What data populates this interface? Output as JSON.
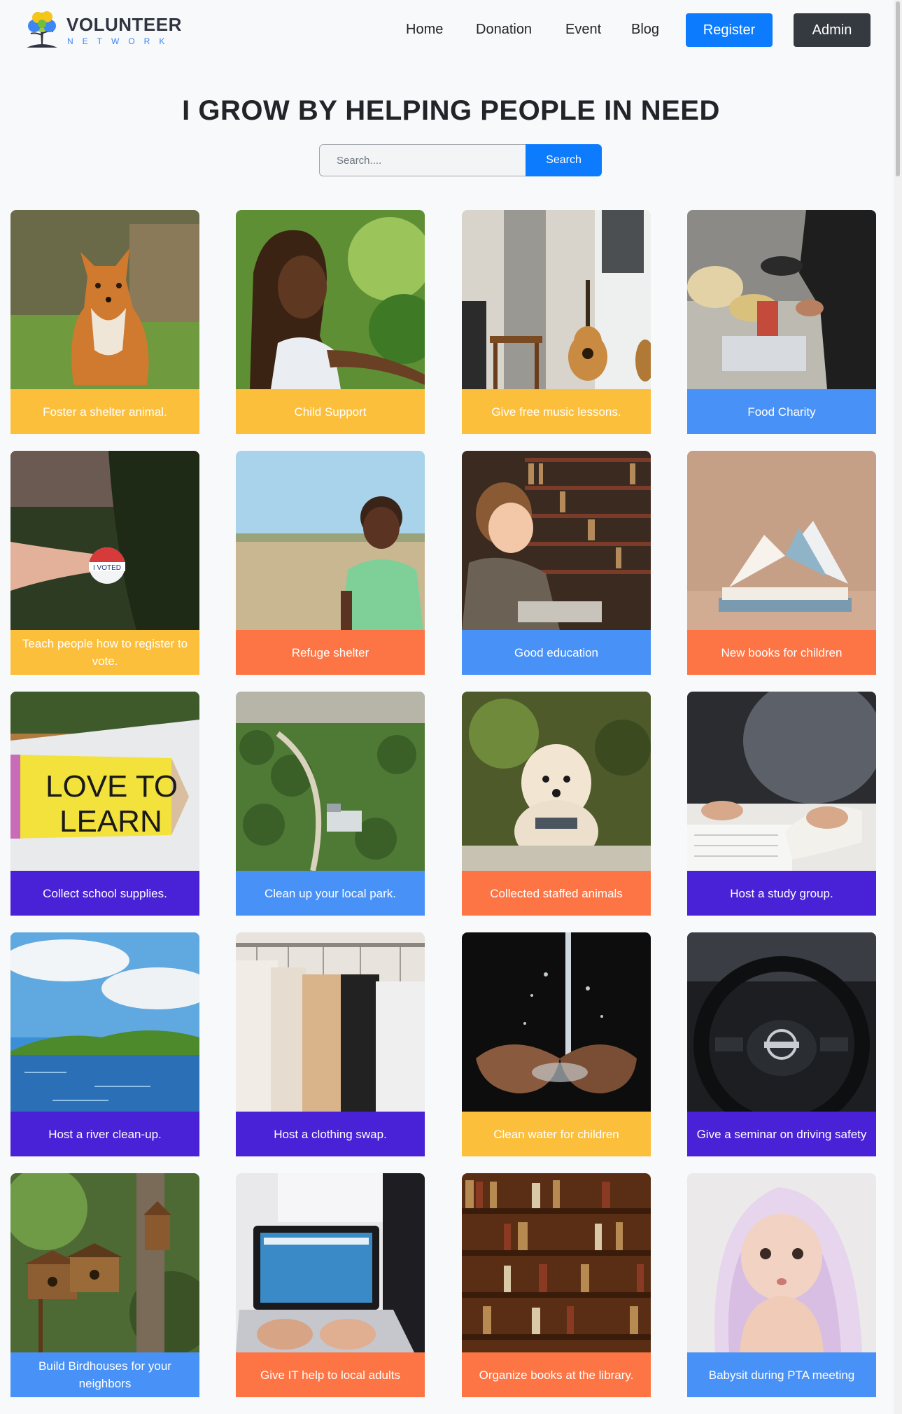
{
  "brand": {
    "title": "VOLUNTEER",
    "subtitle": "NETWORK"
  },
  "nav": {
    "home": "Home",
    "donation": "Donation",
    "event": "Event",
    "blog": "Blog",
    "register": "Register",
    "admin": "Admin"
  },
  "hero": {
    "title": "I GROW BY HELPING PEOPLE IN NEED"
  },
  "search": {
    "placeholder": "Search....",
    "button": "Search"
  },
  "colors": {
    "yellow": "#fcbf3c",
    "blue": "#4891f7",
    "orange": "#fd7545",
    "purple": "#4921d6",
    "primary": "#0d7bfd",
    "dark": "#343a40"
  },
  "events": [
    {
      "title": "Foster a shelter animal.",
      "color": "yellow",
      "image": "fox"
    },
    {
      "title": "Child Support",
      "color": "yellow",
      "image": "smiling-girl"
    },
    {
      "title": "Give free music lessons.",
      "color": "yellow",
      "image": "guitar-room"
    },
    {
      "title": "Food Charity",
      "color": "blue",
      "image": "food-sorting"
    },
    {
      "title": "Teach people how to register to vote.",
      "color": "yellow",
      "image": "voted-sticker"
    },
    {
      "title": "Refuge shelter",
      "color": "orange",
      "image": "boy-in-field"
    },
    {
      "title": "Good education",
      "color": "blue",
      "image": "boy-reading-library"
    },
    {
      "title": "New books for children",
      "color": "orange",
      "image": "open-book"
    },
    {
      "title": "Collect school supplies.",
      "color": "purple",
      "image": "love-to-learn-pencil"
    },
    {
      "title": "Clean up your local park.",
      "color": "blue",
      "image": "city-park"
    },
    {
      "title": "Collected staffed animals",
      "color": "orange",
      "image": "poodle"
    },
    {
      "title": "Host a study group.",
      "color": "purple",
      "image": "study-notes"
    },
    {
      "title": "Host a river clean-up.",
      "color": "purple",
      "image": "river"
    },
    {
      "title": "Host a clothing swap.",
      "color": "purple",
      "image": "clothing-rack"
    },
    {
      "title": "Clean water for children",
      "color": "yellow",
      "image": "water-hands"
    },
    {
      "title": "Give a seminar on driving safety",
      "color": "purple",
      "image": "steering-wheel"
    },
    {
      "title": "Build Birdhouses for your neighbors",
      "color": "blue",
      "image": "birdhouses"
    },
    {
      "title": "Give IT help to local adults",
      "color": "orange",
      "image": "laptop"
    },
    {
      "title": "Organize books at the library.",
      "color": "orange",
      "image": "bookshelf"
    },
    {
      "title": "Babysit during PTA meeting",
      "color": "blue",
      "image": "baby"
    }
  ]
}
